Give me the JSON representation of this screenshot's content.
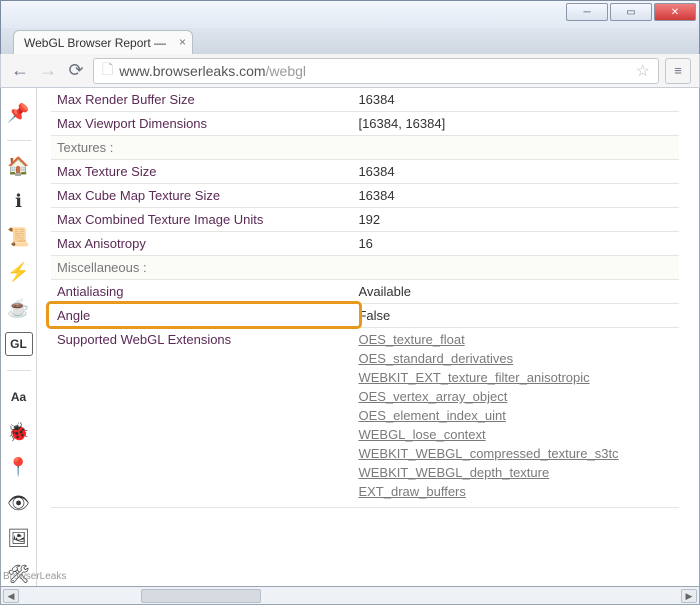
{
  "window": {
    "title": "WebGL Browser Report — ",
    "url_host": "www.browserleaks.com",
    "url_path": "/webgl",
    "brand_label": "BrowserLeaks"
  },
  "sidebar": {
    "icons": [
      "pin-icon",
      "home-icon",
      "info-icon",
      "script-icon",
      "flash-icon",
      "java-icon",
      "webgl-icon",
      "fonts-icon",
      "debug-icon",
      "geo-icon",
      "eye-icon",
      "image-icon",
      "tools-icon"
    ]
  },
  "sections": [
    {
      "rows": [
        {
          "label": "Max Render Buffer Size",
          "value": "16384"
        },
        {
          "label": "Max Viewport Dimensions",
          "value": "[16384, 16384]"
        }
      ]
    },
    {
      "heading": "Textures :",
      "rows": [
        {
          "label": "Max Texture Size",
          "value": "16384"
        },
        {
          "label": "Max Cube Map Texture Size",
          "value": "16384"
        },
        {
          "label": "Max Combined Texture Image Units",
          "value": "192"
        },
        {
          "label": "Max Anisotropy",
          "value": "16"
        }
      ]
    },
    {
      "heading": "Miscellaneous :",
      "rows": [
        {
          "label": "Antialiasing",
          "value": "Available"
        },
        {
          "label": "Angle",
          "value": "False",
          "highlight": true
        },
        {
          "label": "Supported WebGL Extensions",
          "extensions": [
            "OES_texture_float",
            "OES_standard_derivatives",
            "WEBKIT_EXT_texture_filter_anisotropic",
            "OES_vertex_array_object",
            "OES_element_index_uint",
            "WEBGL_lose_context",
            "WEBKIT_WEBGL_compressed_texture_s3tc",
            "WEBKIT_WEBGL_depth_texture",
            "EXT_draw_buffers"
          ]
        }
      ]
    }
  ],
  "icon_glyphs": {
    "pin-icon": "📌",
    "home-icon": "🏠",
    "info-icon": "ℹ",
    "script-icon": "📜",
    "flash-icon": "⚡",
    "java-icon": "☕",
    "webgl-icon": "GL",
    "fonts-icon": "Aa",
    "debug-icon": "🐞",
    "geo-icon": "📍",
    "eye-icon": "👁",
    "image-icon": "🖼",
    "tools-icon": "🛠"
  }
}
